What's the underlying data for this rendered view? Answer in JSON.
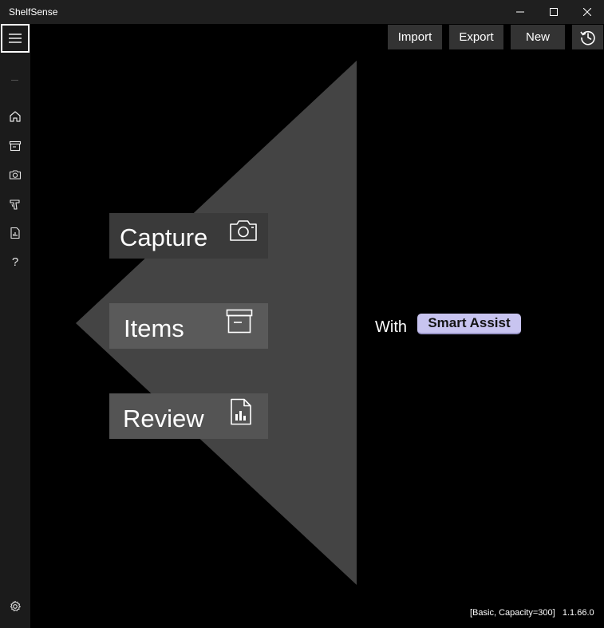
{
  "app": {
    "title": "ShelfSense"
  },
  "toolbar": {
    "import_label": "Import",
    "export_label": "Export",
    "new_label": "New"
  },
  "sidebar": {
    "items": [
      {
        "name": "home",
        "icon": "home-icon"
      },
      {
        "name": "items",
        "icon": "archive-icon"
      },
      {
        "name": "capture",
        "icon": "camera-icon"
      },
      {
        "name": "scan",
        "icon": "barcode-scanner-icon"
      },
      {
        "name": "review",
        "icon": "report-icon"
      },
      {
        "name": "help",
        "icon": "help-icon",
        "label": "?"
      }
    ],
    "settings_icon": "gear-icon"
  },
  "menu": {
    "capture_label": "Capture",
    "items_label": "Items",
    "review_label": "Review"
  },
  "promo": {
    "with_text": "With",
    "badge_label": "Smart Assist"
  },
  "status": {
    "text": "[Basic, Capacity=300]   1.1.66.0"
  },
  "colors": {
    "background": "#000000",
    "sidebar": "#1b1b1b",
    "tile_capture": "#3a3a3a",
    "tile_items": "#5a5a5a",
    "tile_review": "#545454",
    "badge": "#c8c4f0"
  }
}
